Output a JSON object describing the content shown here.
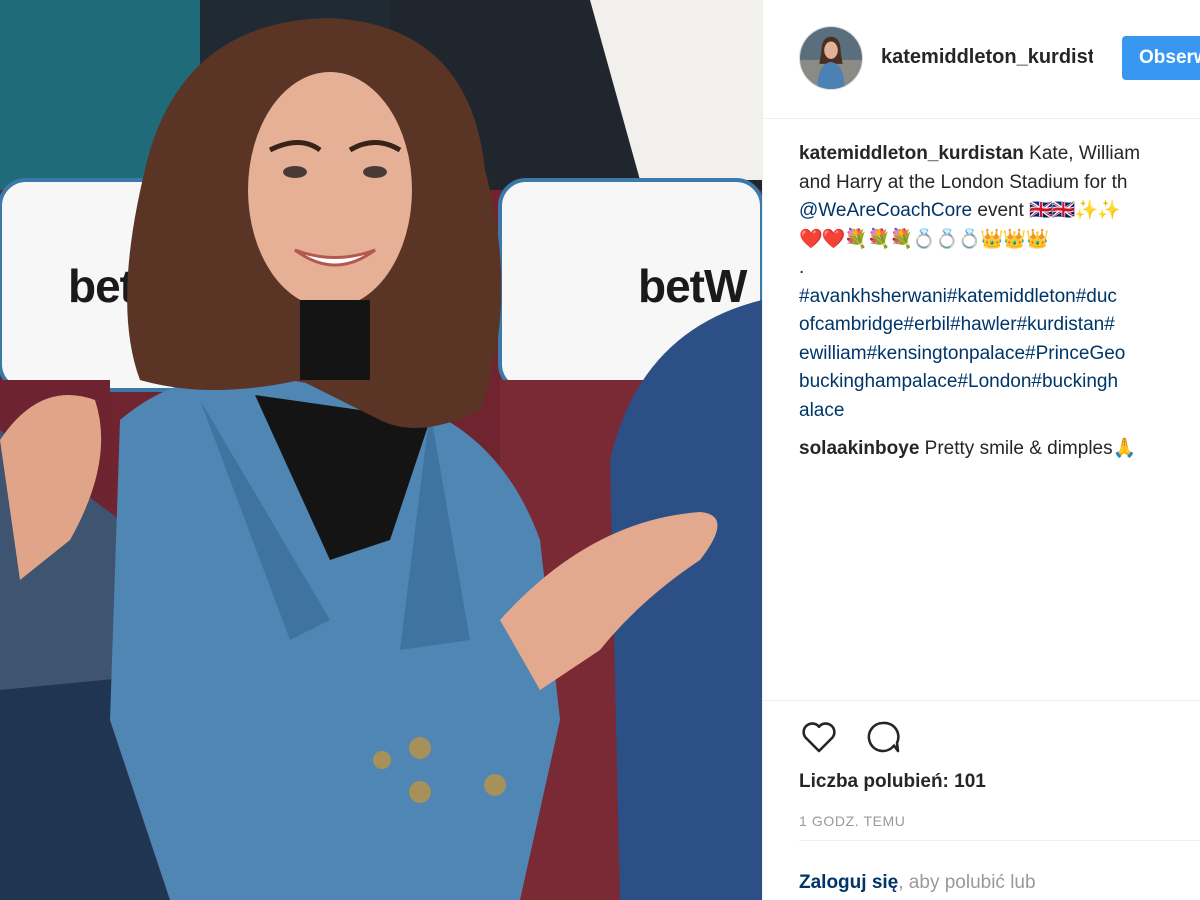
{
  "photo": {
    "sponsor_left": "betW",
    "sponsor_right": "betW"
  },
  "header": {
    "username": "katemiddleton_kurdistan",
    "follow_label": "Obserwuj"
  },
  "caption": {
    "author": "katemiddleton_kurdistan",
    "text_line1": " Kate, William",
    "text_line2": "and Harry at the London Stadium for th",
    "mention": "@WeAreCoachCore",
    "text_line3_rest": " event ",
    "flags": "🇬🇧🇬🇧✨✨",
    "emoji_line": "❤️❤️💐💐💐💍💍💍👑👑👑",
    "dot": ".",
    "hashtags_line1": "#avankhsherwani#katemiddleton#duc",
    "hashtags_line2": "ofcambridge#erbil#hawler#kurdistan#",
    "hashtags_line3": "ewilliam#kensingtonpalace#PrinceGeo",
    "hashtags_line4": "buckinghampalace#London#buckingh",
    "hashtags_line5": "alace"
  },
  "comment": {
    "author": "solaakinboye",
    "text": " Pretty smile & dimples",
    "emoji": "🙏"
  },
  "actions": {
    "like_icon": "heart-icon",
    "comment_icon": "comment-bubble-icon",
    "likes_label": "Liczba polubień: 101",
    "timestamp": "1 GODZ. TEMU"
  },
  "login": {
    "link": "Zaloguj się",
    "rest": ", aby polubić lub"
  },
  "colors": {
    "accent": "#3897f0",
    "link": "#003569",
    "muted": "#999999"
  }
}
